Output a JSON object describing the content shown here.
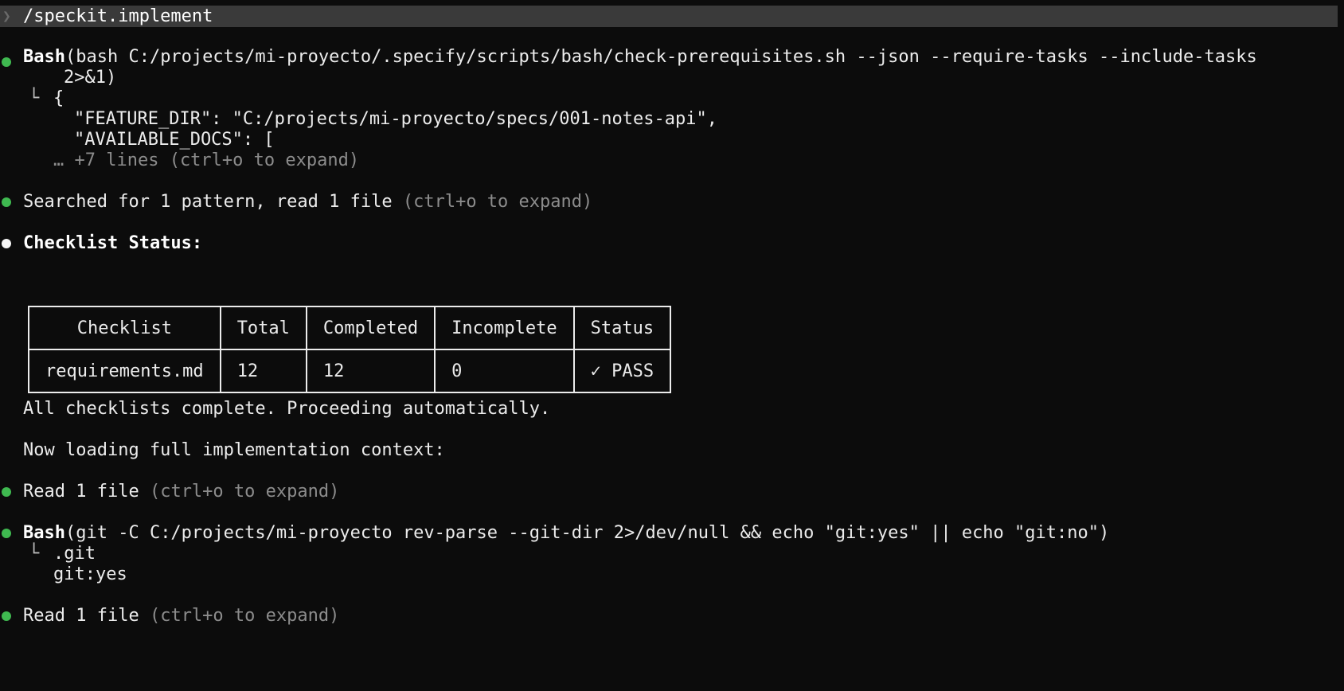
{
  "colors": {
    "background": "#0c0c0c",
    "prompt_bar": "#3a3a3a",
    "bullet_green": "#3fb950",
    "text": "#ececec",
    "dim_text": "#8c8c8c"
  },
  "prompt": {
    "chevron_icon": "chevron-right-icon",
    "command": "/speckit.implement"
  },
  "blocks": {
    "bash1": {
      "tool": "Bash",
      "command_line1": "(bash C:/projects/mi-proyecto/.specify/scripts/bash/check-prerequisites.sh --json --require-tasks --include-tasks",
      "command_line2": "2>&1)",
      "output_corner": "└",
      "output_lines": [
        "{",
        "\"FEATURE_DIR\": \"C:/projects/mi-proyecto/specs/001-notes-api\",",
        "\"AVAILABLE_DOCS\": ["
      ],
      "more_lines": "… +7 lines (ctrl+o to expand)"
    },
    "search": {
      "text": "Searched for 1 pattern, read 1 file",
      "hint": "(ctrl+o to expand)"
    },
    "checklist_heading": "Checklist Status:",
    "table": {
      "headers": [
        "Checklist",
        "Total",
        "Completed",
        "Incomplete",
        "Status"
      ],
      "rows": [
        [
          "requirements.md",
          "12",
          "12",
          "0",
          "✓ PASS"
        ]
      ]
    },
    "all_complete": "All checklists complete. Proceeding automatically.",
    "now_loading": "Now loading full implementation context:",
    "read1": {
      "text": "Read 1 file",
      "hint": "(ctrl+o to expand)"
    },
    "bash2": {
      "tool": "Bash",
      "command": "(git -C C:/projects/mi-proyecto rev-parse --git-dir 2>/dev/null && echo \"git:yes\" || echo \"git:no\")",
      "output_corner": "└",
      "output_lines": [
        ".git",
        "git:yes"
      ]
    },
    "read2": {
      "text": "Read 1 file",
      "hint": "(ctrl+o to expand)"
    }
  }
}
